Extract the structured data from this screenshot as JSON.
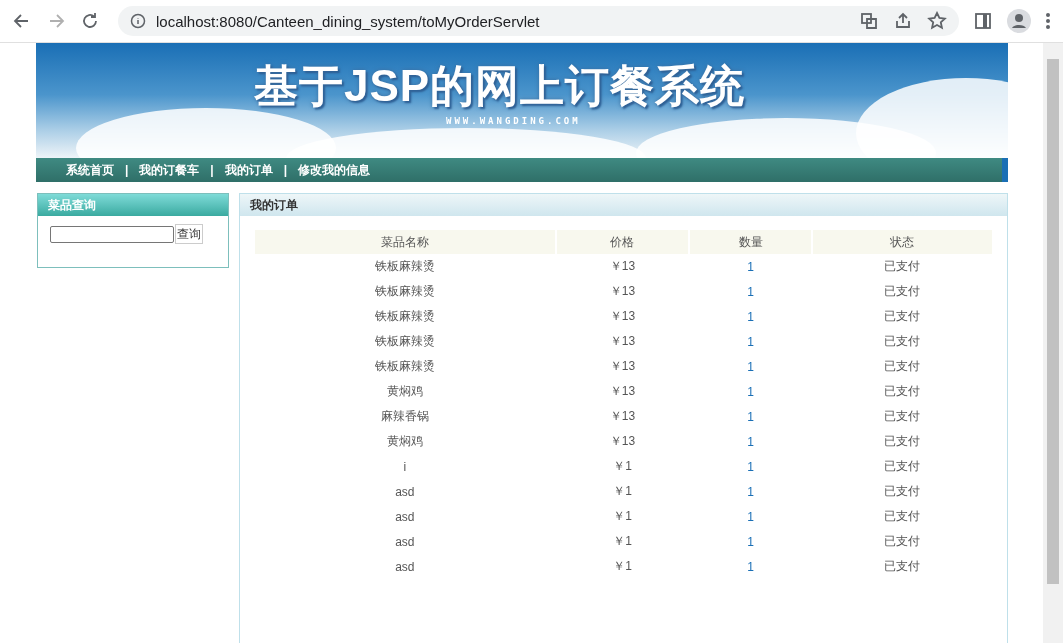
{
  "browser": {
    "url": "localhost:8080/Canteen_dining_system/toMyOrderServlet"
  },
  "banner": {
    "title": "基于JSP的网上订餐系统",
    "subtitle": "WWW.WANGDING.COM"
  },
  "nav": {
    "items": [
      "系统首页",
      "我的订餐车",
      "我的订单",
      "修改我的信息"
    ],
    "separators": [
      "|",
      "|",
      "|"
    ]
  },
  "search": {
    "title": "菜品查询",
    "button": "查询"
  },
  "orders": {
    "title": "我的订单",
    "columns": [
      "菜品名称",
      "价格",
      "数量",
      "状态"
    ],
    "rows": [
      [
        "铁板麻辣烫",
        "￥13",
        "1",
        "已支付"
      ],
      [
        "铁板麻辣烫",
        "￥13",
        "1",
        "已支付"
      ],
      [
        "铁板麻辣烫",
        "￥13",
        "1",
        "已支付"
      ],
      [
        "铁板麻辣烫",
        "￥13",
        "1",
        "已支付"
      ],
      [
        "铁板麻辣烫",
        "￥13",
        "1",
        "已支付"
      ],
      [
        "黄焖鸡",
        "￥13",
        "1",
        "已支付"
      ],
      [
        "麻辣香锅",
        "￥13",
        "1",
        "已支付"
      ],
      [
        "黄焖鸡",
        "￥13",
        "1",
        "已支付"
      ],
      [
        "i",
        "￥1",
        "1",
        "已支付"
      ],
      [
        "asd",
        "￥1",
        "1",
        "已支付"
      ],
      [
        "asd",
        "￥1",
        "1",
        "已支付"
      ],
      [
        "asd",
        "￥1",
        "1",
        "已支付"
      ],
      [
        "asd",
        "￥1",
        "1",
        "已支付"
      ]
    ]
  }
}
